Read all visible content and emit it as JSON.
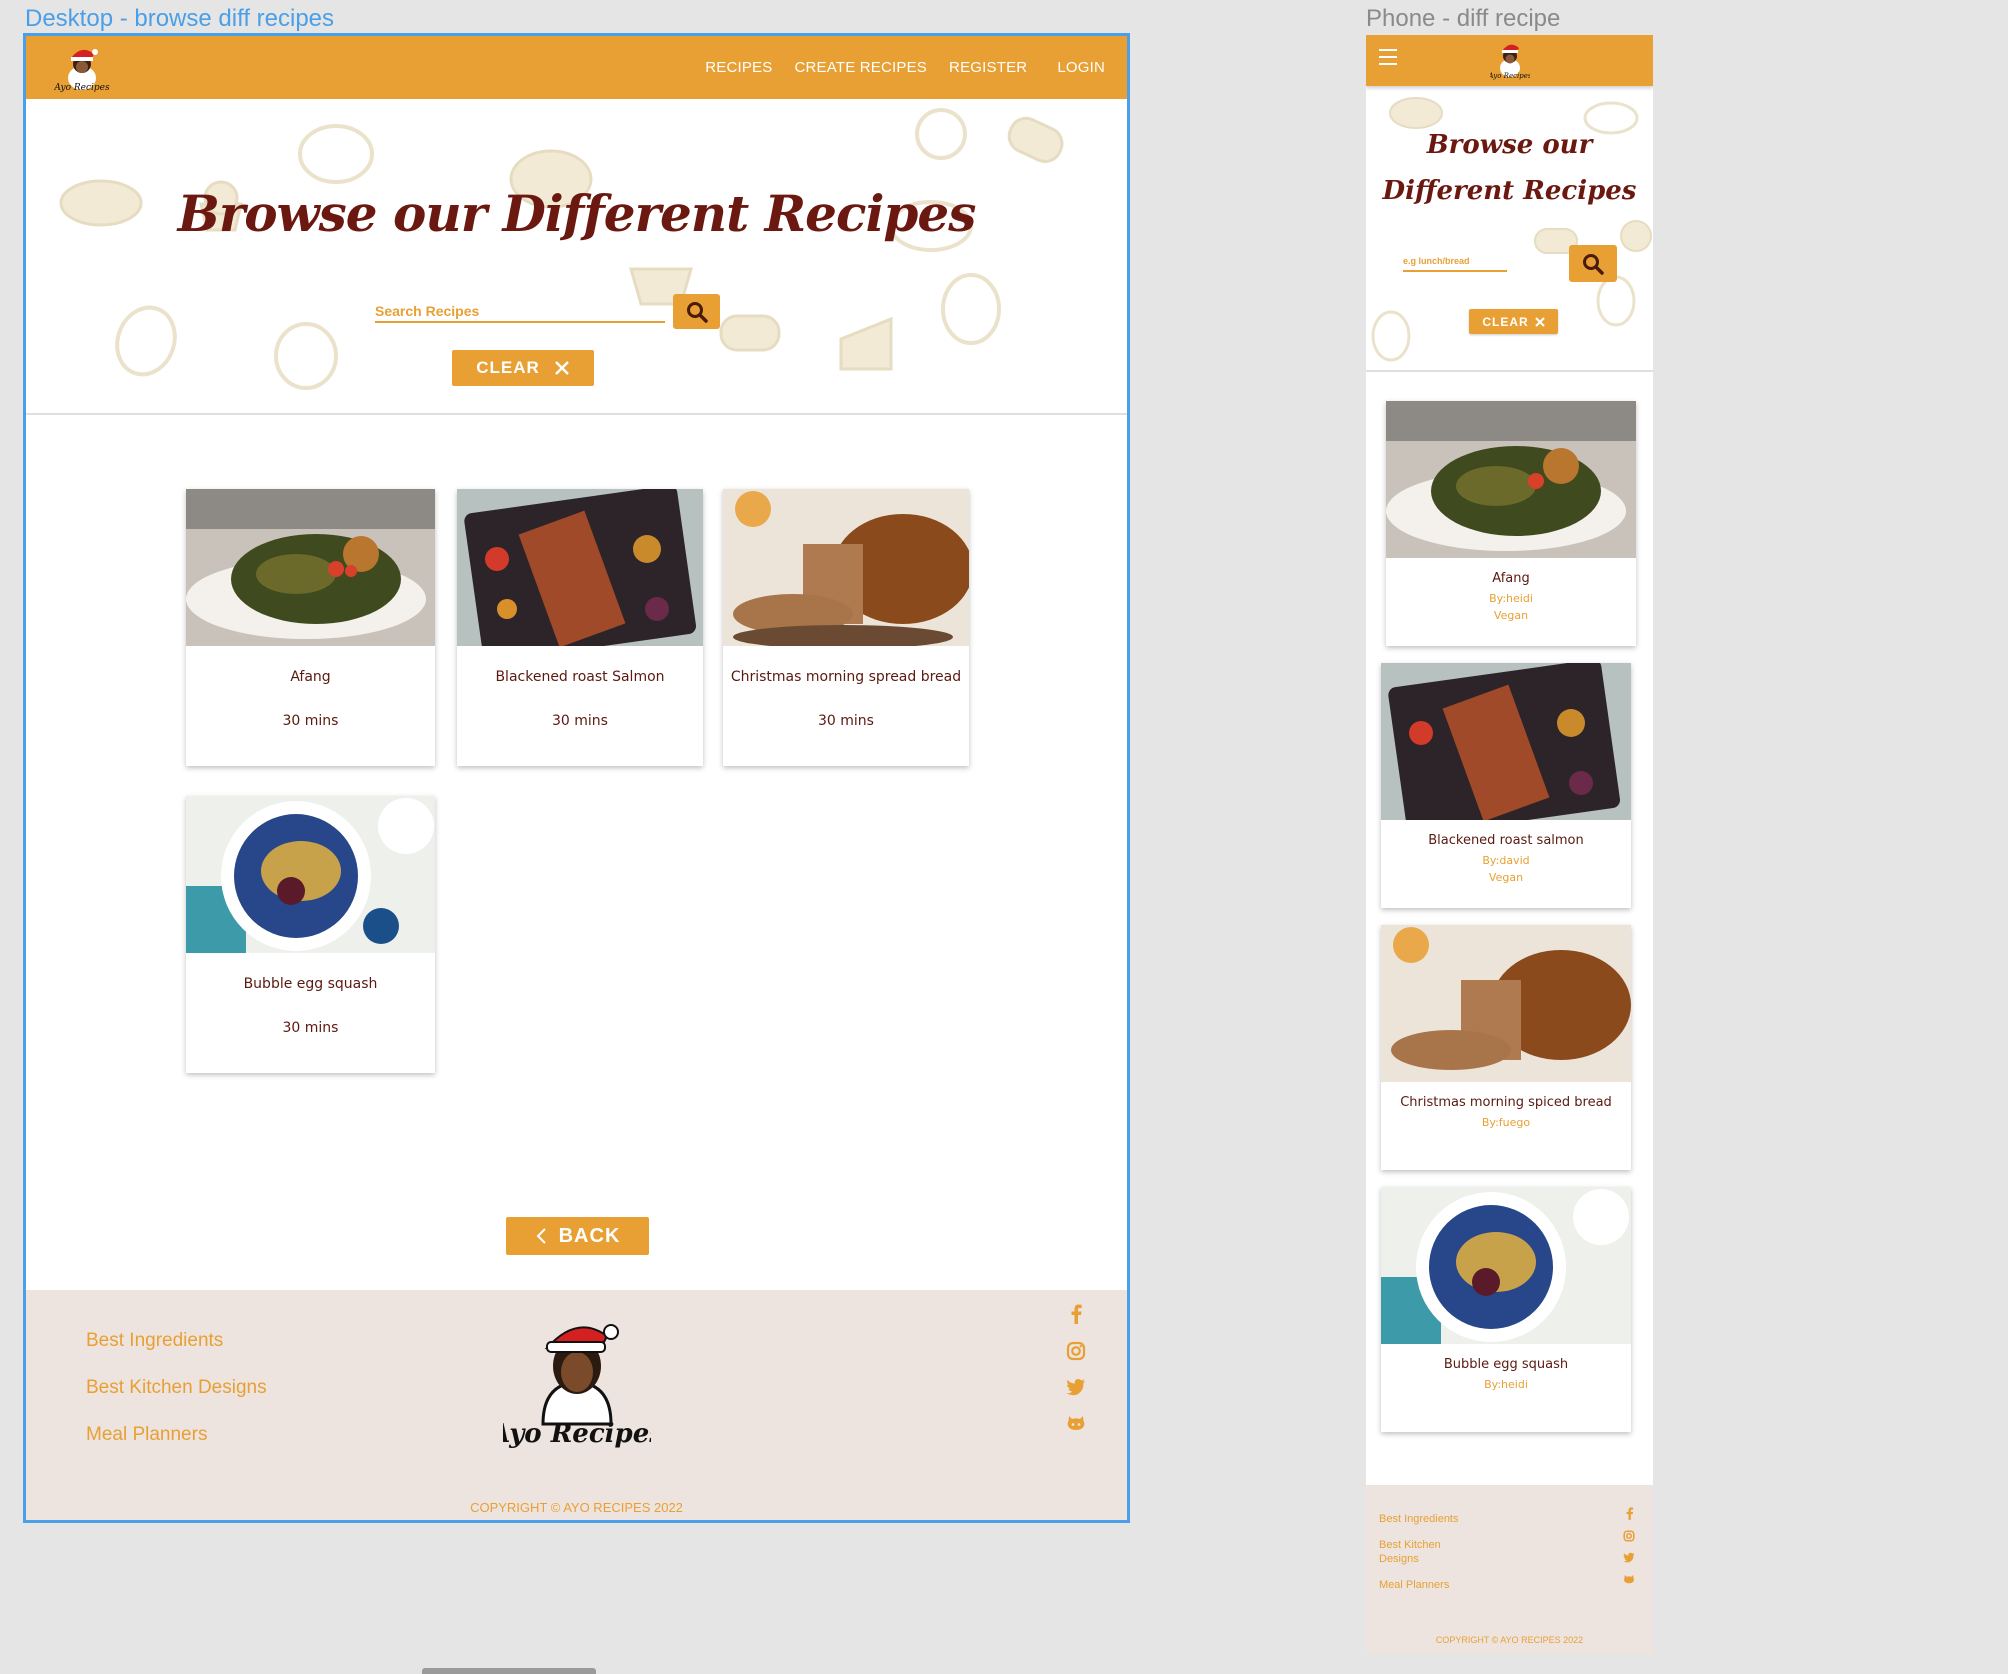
{
  "labels": {
    "desktop": "Desktop - browse diff recipes",
    "phone": "Phone - diff recipe"
  },
  "colors": {
    "primary": "#e8a034",
    "title": "#6b1810",
    "footer_bg": "#ede4e0",
    "frame_border": "#4a9fe8"
  },
  "nav": {
    "links": [
      "RECIPES",
      "CREATE RECIPES",
      "REGISTER",
      "LOGIN"
    ],
    "logo_icon": "chef-logo-icon",
    "menu_icon": "hamburger-menu-icon"
  },
  "hero": {
    "title": "Browse our Different Recipes",
    "phone_title_line1": "Browse our",
    "phone_title_line2": "Different Recipes",
    "search_placeholder": "Search Recipes",
    "phone_search_placeholder": "e.g lunch/bread",
    "clear_label": "CLEAR",
    "search_icon": "magnifier-icon",
    "clear_icon": "close-x-icon"
  },
  "desktop_recipes": [
    {
      "name": "Afang",
      "time": "30 mins"
    },
    {
      "name": "Blackened roast Salmon",
      "time": "30 mins"
    },
    {
      "name": "Christmas morning spread bread",
      "time": "30 mins"
    },
    {
      "name": "Bubble egg squash",
      "time": "30 mins"
    }
  ],
  "phone_recipes": [
    {
      "name": "Afang",
      "by": "By:heidi",
      "tag": "Vegan"
    },
    {
      "name": "Blackened roast salmon",
      "by": "By:david",
      "tag": "Vegan"
    },
    {
      "name": "Christmas morning spiced bread",
      "by": "By:fuego",
      "tag": ""
    },
    {
      "name": "Bubble egg squash",
      "by": "By:heidi",
      "tag": ""
    }
  ],
  "back_label": "BACK",
  "footer": {
    "links": [
      "Best Ingredients",
      "Best Kitchen Designs",
      "Meal Planners"
    ],
    "logo_text": "Ayo Recipes",
    "social_icons": [
      "facebook-icon",
      "instagram-icon",
      "twitter-icon",
      "github-icon"
    ],
    "copyright": "COPYRIGHT © AYO RECIPES 2022"
  }
}
